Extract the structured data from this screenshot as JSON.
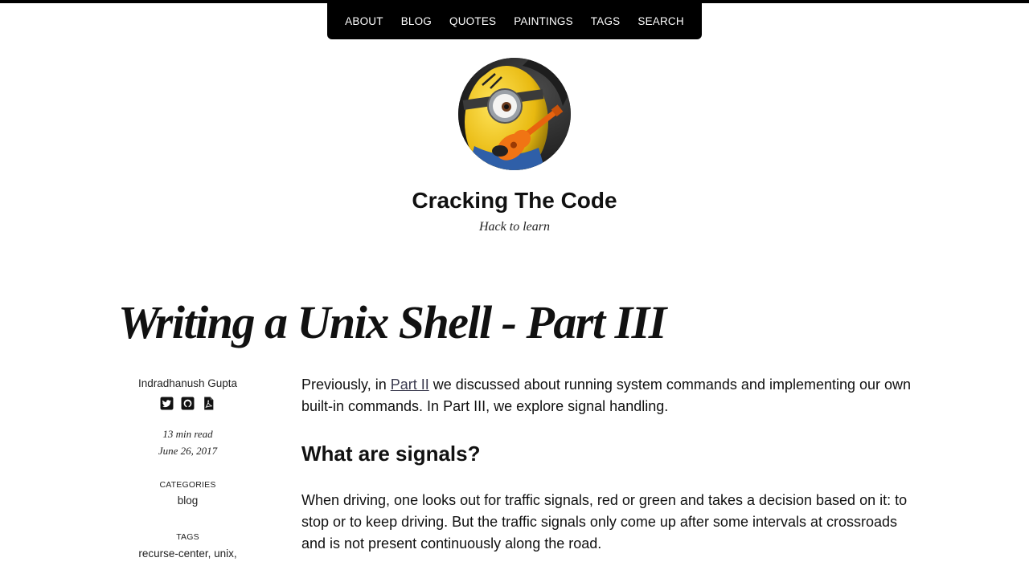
{
  "nav": {
    "items": [
      {
        "label": "ABOUT"
      },
      {
        "label": "BLOG"
      },
      {
        "label": "QUOTES"
      },
      {
        "label": "PAINTINGS"
      },
      {
        "label": "TAGS"
      },
      {
        "label": "SEARCH"
      }
    ]
  },
  "site": {
    "title": "Cracking The Code",
    "tagline": "Hack to learn",
    "avatar_icon": "minion-with-guitar-avatar"
  },
  "post": {
    "title": "Writing a Unix Shell - Part III",
    "author": "Indradhanush Gupta",
    "social_icons": [
      "twitter-icon",
      "github-icon",
      "pdf-icon"
    ],
    "read_time": "13 min read",
    "date": "June 26, 2017",
    "categories_label": "CATEGORIES",
    "category": "blog",
    "tags_label": "TAGS",
    "tags": [
      "recurse-center",
      "unix"
    ],
    "intro_before_link": "Previously, in ",
    "intro_link": "Part II",
    "intro_after_link": " we discussed about running system commands and implementing our own built-in commands. In Part III, we explore signal handling.",
    "heading_signals": "What are signals?",
    "para_signals": "When driving, one looks out for traffic signals, red or green and takes a decision based on it: to stop or to keep driving. But the traffic signals only come up after some intervals at crossroads and is not present continuously along the road."
  },
  "colors": {
    "nav_bg": "#000000",
    "link": "#3a3a4f",
    "text": "#111111"
  }
}
